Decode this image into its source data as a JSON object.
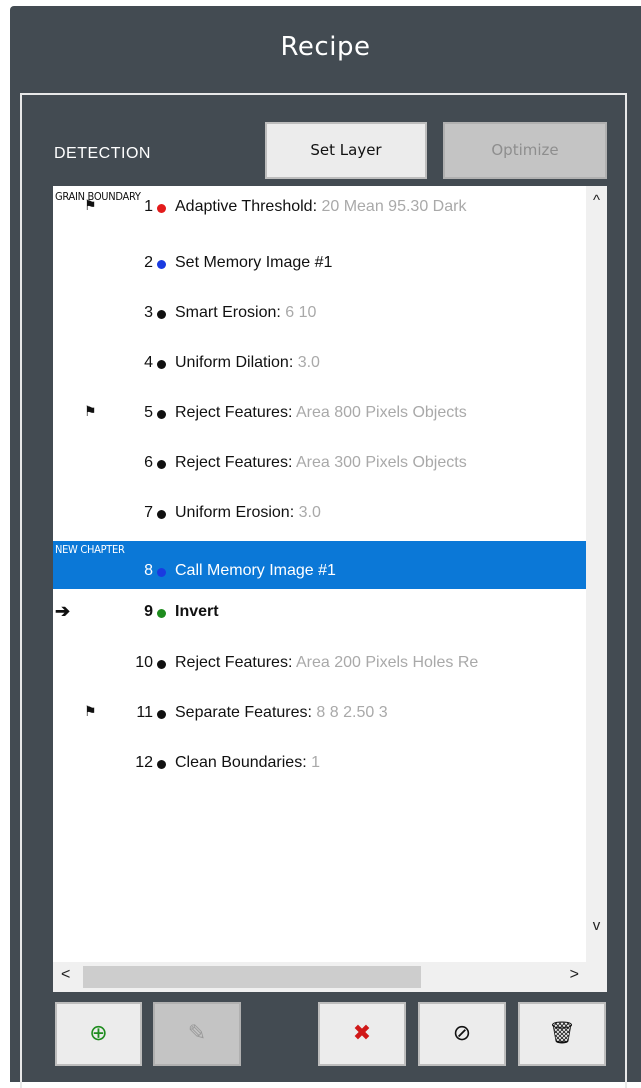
{
  "title": "Recipe",
  "section_label": "DETECTION",
  "buttons": {
    "set_layer": "Set Layer",
    "optimize": "Optimize"
  },
  "chapters": [
    {
      "label": "GRAIN BOUNDARY"
    },
    {
      "label": "NEW CHAPTER"
    }
  ],
  "steps": [
    {
      "num": "1",
      "dot": "#e31b1b",
      "flag": true,
      "name": "Adaptive Threshold:",
      "params": " 20 Mean 95.30 Dark"
    },
    {
      "num": "2",
      "dot": "#1a3be0",
      "flag": false,
      "name": "Set Memory Image #1",
      "params": ""
    },
    {
      "num": "3",
      "dot": "#111111",
      "flag": false,
      "name": "Smart Erosion:",
      "params": " 6 10"
    },
    {
      "num": "4",
      "dot": "#111111",
      "flag": false,
      "name": "Uniform Dilation:",
      "params": " 3.0"
    },
    {
      "num": "5",
      "dot": "#111111",
      "flag": true,
      "name": "Reject Features:",
      "params": " Area 800 Pixels Objects"
    },
    {
      "num": "6",
      "dot": "#111111",
      "flag": false,
      "name": "Reject Features:",
      "params": " Area 300 Pixels Objects"
    },
    {
      "num": "7",
      "dot": "#111111",
      "flag": false,
      "name": "Uniform Erosion:",
      "params": " 3.0"
    },
    {
      "num": "8",
      "dot": "#1a3be0",
      "flag": false,
      "name": "Call Memory Image #1",
      "params": ""
    },
    {
      "num": "9",
      "dot": "#1e8c1e",
      "flag": false,
      "name": "Invert",
      "params": ""
    },
    {
      "num": "10",
      "dot": "#111111",
      "flag": false,
      "name": "Reject Features:",
      "params": " Area 200 Pixels Holes Re"
    },
    {
      "num": "11",
      "dot": "#111111",
      "flag": true,
      "name": "Separate Features:",
      "params": " 8 8 2.50 3"
    },
    {
      "num": "12",
      "dot": "#111111",
      "flag": false,
      "name": "Clean Boundaries:",
      "params": " 1"
    }
  ],
  "selected_step": "8",
  "current_step_marker": "➔",
  "flag_glyph": "⚑",
  "scroll": {
    "up": "^",
    "down": "v",
    "left": "<",
    "right": ">"
  },
  "toolbar": [
    {
      "name": "add-step-button",
      "icon": "crosshair-icon",
      "glyph": "⊕",
      "color": "#1e8c1e",
      "enabled": true
    },
    {
      "name": "edit-step-button",
      "icon": "pencil-icon",
      "glyph": "✎",
      "color": "#9a9a9a",
      "enabled": false
    },
    {
      "name": "delete-step-button",
      "icon": "red-x-icon",
      "glyph": "✖",
      "color": "#d01818",
      "enabled": true
    },
    {
      "name": "disable-step-button",
      "icon": "prohibited-icon",
      "glyph": "⊘",
      "color": "#111111",
      "enabled": true
    },
    {
      "name": "trash-button",
      "icon": "trash-icon",
      "glyph": "🗑",
      "color": "#111111",
      "enabled": true
    }
  ]
}
